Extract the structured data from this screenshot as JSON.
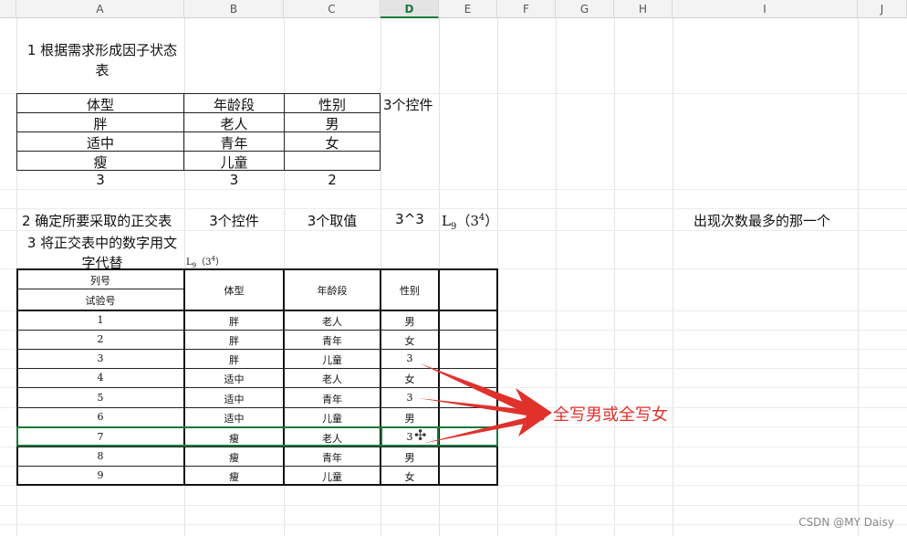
{
  "columns": [
    "A",
    "B",
    "C",
    "D",
    "E",
    "F",
    "G",
    "H",
    "I",
    "J"
  ],
  "active_column": "D",
  "section1": {
    "title": "1 根据需求形成因子状态表",
    "headers": [
      "体型",
      "年龄段",
      "性别"
    ],
    "rows": [
      [
        "胖",
        "老人",
        "男"
      ],
      [
        "适中",
        "青年",
        "女"
      ],
      [
        "瘦",
        "儿童",
        ""
      ]
    ],
    "counts": [
      "3",
      "3",
      "2"
    ],
    "note": "3个控件"
  },
  "section2": {
    "label": "2 确定所要采取的正交表",
    "b": "3个控件",
    "c": "3个取值",
    "d": "3^3",
    "e_main": "L",
    "e_sub": "9",
    "e_paren": "（3",
    "e_sup": "4",
    "e_close": "）",
    "i": "出现次数最多的那一个"
  },
  "section3": {
    "label": "3 将正交表中的数字用文字代替",
    "small_L": "L",
    "small_sub": "9",
    "small_paren": "（3",
    "small_sup": "4",
    "small_close": "）"
  },
  "table": {
    "h_col": "列号",
    "h_trial": "试验号",
    "headers": [
      "体型",
      "年龄段",
      "性别"
    ],
    "rows": [
      [
        "1",
        "胖",
        "老人",
        "男"
      ],
      [
        "2",
        "胖",
        "青年",
        "女"
      ],
      [
        "3",
        "胖",
        "儿童",
        "3"
      ],
      [
        "4",
        "适中",
        "老人",
        "女"
      ],
      [
        "5",
        "适中",
        "青年",
        "3"
      ],
      [
        "6",
        "适中",
        "儿童",
        "男"
      ],
      [
        "7",
        "瘦",
        "老人",
        "3"
      ],
      [
        "8",
        "瘦",
        "青年",
        "男"
      ],
      [
        "9",
        "瘦",
        "儿童",
        "女"
      ]
    ]
  },
  "annotation": "全写男或全写女",
  "watermark": "CSDN @MY Daisy",
  "arrow_color": "#e0312b"
}
